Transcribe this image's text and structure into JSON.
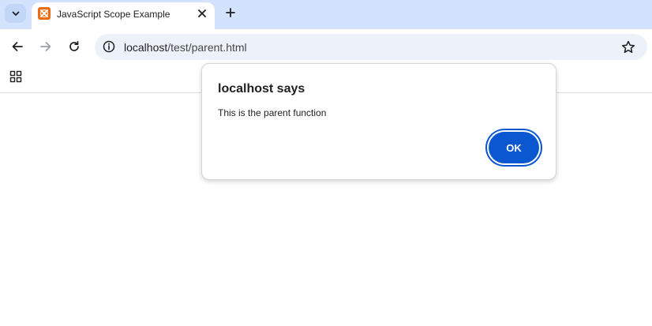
{
  "browser": {
    "tab": {
      "title": "JavaScript Scope Example",
      "favicon_color": "#ea6b12"
    },
    "toolbar": {
      "url_host": "localhost",
      "url_path": "/test/parent.html"
    },
    "colors": {
      "tabstrip": "#d3e3fd",
      "omnibox": "#edf2fa",
      "accent": "#0b57d0"
    }
  },
  "dialog": {
    "title": "localhost says",
    "message": "This is the parent function",
    "ok_label": "OK"
  }
}
